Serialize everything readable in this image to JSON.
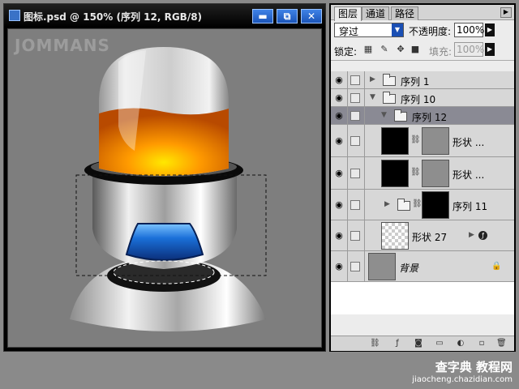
{
  "document": {
    "title": "图标.psd @ 150% (序列 12, RGB/8)",
    "buttons": {
      "minimize": "▬",
      "restore": "⧉",
      "close": "✕"
    },
    "watermark": "JOMMANS"
  },
  "layers_panel": {
    "tabs": [
      "图层",
      "通道",
      "路径"
    ],
    "blend_mode": "穿过",
    "opacity_label": "不透明度:",
    "opacity_value": "100%",
    "lock_label": "锁定:",
    "fill_label": "填充:",
    "fill_value": "100%",
    "layers": [
      {
        "name": "序列 1",
        "type": "group",
        "collapsed": true
      },
      {
        "name": "序列 10",
        "type": "group",
        "collapsed": false
      },
      {
        "name": "序列 12",
        "type": "group",
        "collapsed": false,
        "selected": true
      },
      {
        "name": "形状 ...",
        "type": "shape"
      },
      {
        "name": "形状 ...",
        "type": "shape"
      },
      {
        "name": "序列 11",
        "type": "group",
        "collapsed": true
      },
      {
        "name": "形状 27",
        "type": "shape",
        "has_fx": true
      },
      {
        "name": "背景",
        "type": "background",
        "locked": true
      }
    ]
  },
  "site_watermark": {
    "line1": "查字典 教程网",
    "line2": "jiaocheng.chazidian.com"
  },
  "colors": {
    "selection_blue": "#1a4fb4",
    "group_selected": "#8a8a94"
  }
}
